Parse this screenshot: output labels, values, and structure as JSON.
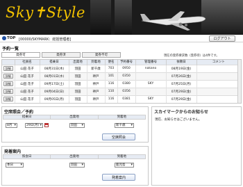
{
  "header": {
    "logo_text": "Sky✝Style"
  },
  "topbar": {
    "home_label": "TOP",
    "user_label": "[00000/SKYMARK：総括管理者]",
    "logout_label": "ログアウト"
  },
  "reservations": {
    "title": "予約一覧",
    "tabs": [
      "発券可",
      "発券済",
      "発券不可"
    ],
    "count_note": "現在の発券要求数（発券待）は4件です。",
    "columns": [
      "",
      "社員名",
      "搭乗日",
      "出発地",
      "到着地",
      "便名",
      "予約番号",
      "管理番号",
      "依頼日",
      "コメント"
    ],
    "detail_label": "詳細",
    "rows": [
      [
        "山田 花子",
        "08月31日(木)",
        "羽田",
        "新千歳",
        "703",
        "0950",
        "nakano",
        "08月19日(金)",
        ""
      ],
      [
        "山田 花子",
        "08月01日(水)",
        "羽田",
        "神戸",
        "101",
        "0350",
        "",
        "07月26日(金)",
        ""
      ],
      [
        "山田 花子",
        "09月17日(土)",
        "羽田",
        "神戸",
        "116",
        "0380",
        "SKY",
        "07月25日(月)",
        ""
      ],
      [
        "山田 花子",
        "09月04日(日)",
        "羽田",
        "神戸",
        "110",
        "0356",
        "",
        "07月29日(金)",
        ""
      ],
      [
        "山田 花子",
        "09月05日(月)",
        "羽田",
        "神戸",
        "116",
        "0381",
        "SKY",
        "07月29日(金)",
        ""
      ]
    ]
  },
  "vacancy": {
    "title": "空席照会／予約",
    "headers": [
      "搭乗日",
      "出発地",
      "到着地"
    ],
    "month": "8月",
    "day": "29日(月)",
    "departure": "羽田",
    "arrival": "新千歳",
    "button": "空席照会"
  },
  "departures": {
    "title": "発着案内",
    "headers": [
      "照会日",
      "出発地",
      "到着地"
    ],
    "date": "本日",
    "departure": "羽田",
    "arrival": "鹿児島",
    "button": "発着案内"
  },
  "news": {
    "title": "スカイマークからのお知らせ",
    "body": "現在、お知らせはございません。"
  }
}
